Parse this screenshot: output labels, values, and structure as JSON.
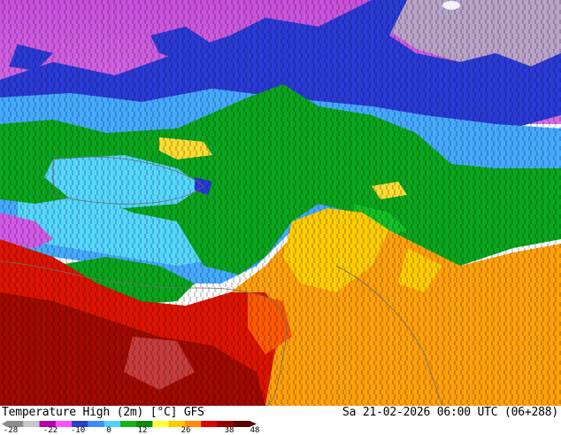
{
  "map": {
    "title": "Temperature High (2m) [°C] GFS",
    "datetime": "Sa 21-02-2026 06:00 UTC (06+288)"
  },
  "legend": {
    "ticks": [
      "-28",
      "-22",
      "-10",
      "0",
      "12",
      "26",
      "38",
      "48"
    ],
    "colors": [
      "#8c8c8c",
      "#c8c8c8",
      "#b400b4",
      "#ff50ff",
      "#2840c8",
      "#3c8cff",
      "#50d2ff",
      "#14b414",
      "#0a8c0a",
      "#ffff32",
      "#ffc800",
      "#ff8c00",
      "#e10000",
      "#960000",
      "#5a0000"
    ]
  },
  "colors": {
    "magenta": "#d25ae6",
    "deep_blue": "#2837d2",
    "light_blue": "#41aaff",
    "green": "#0aa51e",
    "yellow": "#ffdc00",
    "orange": "#ffa00a",
    "red": "#dc1400",
    "dark_red": "#a00a00"
  }
}
